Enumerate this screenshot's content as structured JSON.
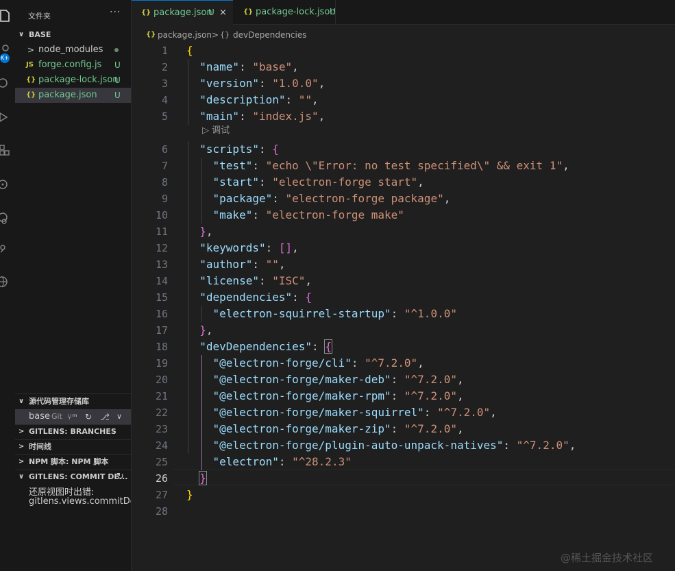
{
  "colors": {
    "background": "#1f1f1f",
    "sidebar": "#181818",
    "accent": "#0078d4",
    "untracked": "#73c991",
    "json_icon": "#cbcb41",
    "js_icon": "#cbcb41"
  },
  "activity_bar": {
    "badge": "K+"
  },
  "sidebar": {
    "title": "文件夹",
    "more": "···",
    "folder": "BASE",
    "files": [
      {
        "icon": "folder-icon",
        "glyph": ">",
        "name": "node_modules",
        "status": ""
      },
      {
        "icon": "js-file-icon",
        "glyph": "JS",
        "name": "forge.config.js",
        "status": "U"
      },
      {
        "icon": "json-file-icon",
        "glyph": "{}",
        "name": "package-lock.json",
        "status": "U"
      },
      {
        "icon": "json-file-icon",
        "glyph": "{}",
        "name": "package.json",
        "status": "U"
      }
    ],
    "scm_title": "源代码管理存储库",
    "scm_repo": "base",
    "scm_kind": "Git",
    "branches_title": "GITLENS: BRANCHES",
    "timeline_title": "时间线",
    "npm_title": "NPM 脚本: NPM 脚本",
    "commit_title": "GITLENS: COMMIT DE...",
    "error_line1": "还原视图时出错:",
    "error_line2": "gitlens.views.commitDetai"
  },
  "tabs": [
    {
      "icon": "{}",
      "label": "package.json",
      "status": "U",
      "close": "×",
      "active": true
    },
    {
      "icon": "{}",
      "label": "package-lock.json",
      "status": "U",
      "close": "",
      "active": false
    }
  ],
  "breadcrumb": {
    "file_icon": "{}",
    "file": "package.json",
    "sep": ">",
    "node_icon": "{}",
    "node": "devDependencies"
  },
  "codelens": {
    "icon": "▷",
    "label": "调试"
  },
  "cursor_line": 26,
  "code_lines": [
    {
      "n": "1",
      "text": "{"
    },
    {
      "n": "2",
      "text": "  \"name\": \"base\","
    },
    {
      "n": "3",
      "text": "  \"version\": \"1.0.0\","
    },
    {
      "n": "4",
      "text": "  \"description\": \"\","
    },
    {
      "n": "5",
      "text": "  \"main\": \"index.js\","
    },
    {
      "n": "6",
      "text": "  \"scripts\": {"
    },
    {
      "n": "7",
      "text": "    \"test\": \"echo \\\"Error: no test specified\\\" && exit 1\","
    },
    {
      "n": "8",
      "text": "    \"start\": \"electron-forge start\","
    },
    {
      "n": "9",
      "text": "    \"package\": \"electron-forge package\","
    },
    {
      "n": "10",
      "text": "    \"make\": \"electron-forge make\""
    },
    {
      "n": "11",
      "text": "  },"
    },
    {
      "n": "12",
      "text": "  \"keywords\": [],"
    },
    {
      "n": "13",
      "text": "  \"author\": \"\","
    },
    {
      "n": "14",
      "text": "  \"license\": \"ISC\","
    },
    {
      "n": "15",
      "text": "  \"dependencies\": {"
    },
    {
      "n": "16",
      "text": "    \"electron-squirrel-startup\": \"^1.0.0\""
    },
    {
      "n": "17",
      "text": "  },"
    },
    {
      "n": "18",
      "text": "  \"devDependencies\": {"
    },
    {
      "n": "19",
      "text": "    \"@electron-forge/cli\": \"^7.2.0\","
    },
    {
      "n": "20",
      "text": "    \"@electron-forge/maker-deb\": \"^7.2.0\","
    },
    {
      "n": "21",
      "text": "    \"@electron-forge/maker-rpm\": \"^7.2.0\","
    },
    {
      "n": "22",
      "text": "    \"@electron-forge/maker-squirrel\": \"^7.2.0\","
    },
    {
      "n": "23",
      "text": "    \"@electron-forge/maker-zip\": \"^7.2.0\","
    },
    {
      "n": "24",
      "text": "    \"@electron-forge/plugin-auto-unpack-natives\": \"^7.2.0\","
    },
    {
      "n": "25",
      "text": "    \"electron\": \"^28.2.3\""
    },
    {
      "n": "26",
      "text": "  }"
    },
    {
      "n": "27",
      "text": "}"
    },
    {
      "n": "28",
      "text": ""
    }
  ],
  "watermark": "@稀土掘金技术社区"
}
